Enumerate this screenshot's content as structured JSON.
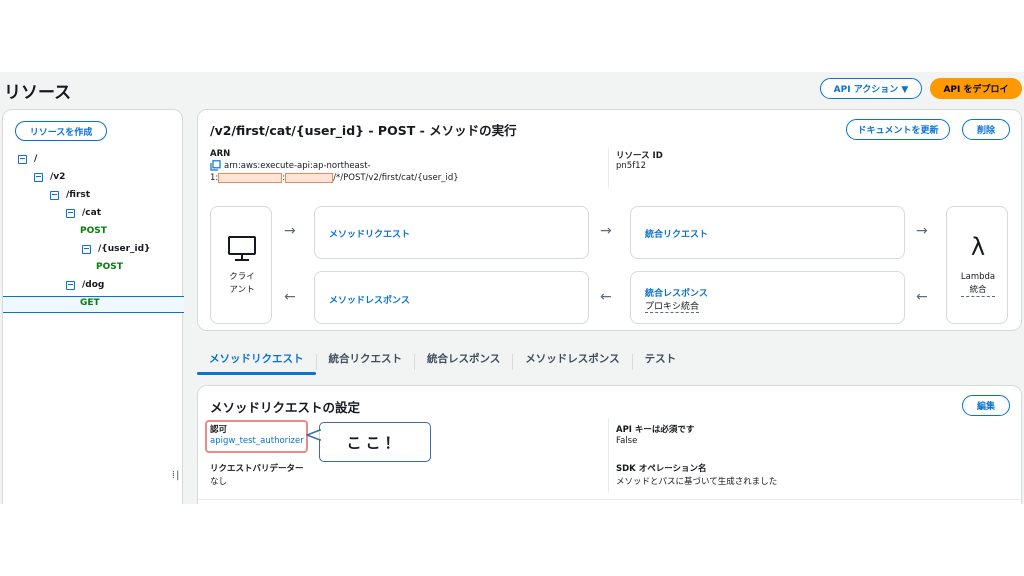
{
  "header": {
    "title": "リソース",
    "api_actions_label": "API アクション ▼",
    "deploy_label": "API をデプロイ"
  },
  "sidebar": {
    "create_resource_label": "リソースを作成",
    "tree": [
      {
        "label": "/",
        "kind": "resource"
      },
      {
        "label": "/v2",
        "kind": "resource"
      },
      {
        "label": "/first",
        "kind": "resource"
      },
      {
        "label": "/cat",
        "kind": "resource"
      },
      {
        "label": "POST",
        "kind": "method"
      },
      {
        "label": "/{user_id}",
        "kind": "resource"
      },
      {
        "label": "POST",
        "kind": "method",
        "selected": true
      },
      {
        "label": "/dog",
        "kind": "resource"
      },
      {
        "label": "GET",
        "kind": "method"
      }
    ]
  },
  "detail": {
    "title": "/v2/first/cat/{user_id} - POST - メソッドの実行",
    "update_docs_label": "ドキュメントを更新",
    "delete_label": "削除",
    "arn_label": "ARN",
    "arn_line1": "arn:aws:execute-api:ap-northeast-",
    "arn_prefix": "1:",
    "arn_sep": ":",
    "arn_suffix": "/*/POST/v2/first/cat/{user_id}",
    "resource_id_label": "リソース ID",
    "resource_id_value": "pn5f12"
  },
  "flow": {
    "client_line1": "クライ",
    "client_line2": "アント",
    "method_request": "メソッドリクエスト",
    "integration_request": "統合リクエスト",
    "method_response": "メソッドレスポンス",
    "integration_response": "統合レスポンス",
    "proxy_integration": "プロキシ統合",
    "lambda_line1": "Lambda",
    "lambda_line2": "統合",
    "arrow_right": "→",
    "arrow_left": "←",
    "lambda_symbol": "λ"
  },
  "tabs": [
    {
      "label": "メソッドリクエスト",
      "active": true
    },
    {
      "label": "統合リクエスト",
      "active": false
    },
    {
      "label": "統合レスポンス",
      "active": false
    },
    {
      "label": "メソッドレスポンス",
      "active": false
    },
    {
      "label": "テスト",
      "active": false
    }
  ],
  "settings": {
    "title": "メソッドリクエストの設定",
    "edit_label": "編集",
    "auth_label": "認可",
    "auth_value": "apigw_test_authorizer",
    "validator_label": "リクエストバリデーター",
    "validator_value": "なし",
    "api_key_label": "API キーは必須です",
    "api_key_value": "False",
    "sdk_label": "SDK オペレーション名",
    "sdk_value": "メソッドとパスに基づいて生成されました"
  },
  "annotation": {
    "callout_text": "ここ！",
    "highlight_color": "#f08a8a",
    "callout_border_color": "#3b6ea5"
  },
  "colors": {
    "accent_blue": "#0972d3",
    "deploy_orange": "#ff9900",
    "method_green": "#037f0c",
    "masked_fill": "#fde4d5"
  }
}
